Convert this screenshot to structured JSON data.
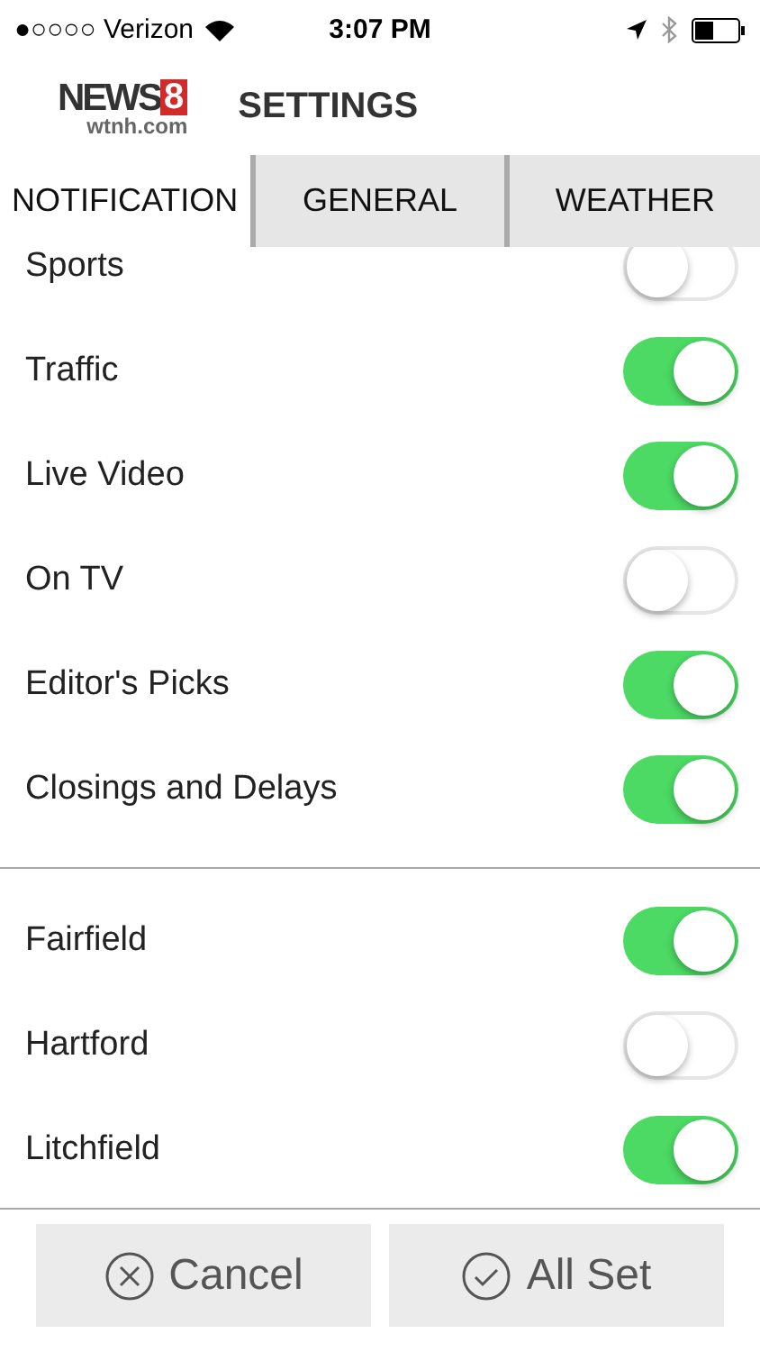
{
  "status_bar": {
    "carrier": "●○○○○ Verizon",
    "time": "3:07 PM"
  },
  "header": {
    "logo": {
      "word": "NEWS",
      "number": "8",
      "site": "wtnh.com"
    },
    "title": "SETTINGS"
  },
  "tabs": [
    {
      "label": "NOTIFICATION",
      "selected": true
    },
    {
      "label": "GENERAL",
      "selected": false
    },
    {
      "label": "WEATHER",
      "selected": false
    }
  ],
  "sections": [
    {
      "items": [
        {
          "label": "Sports",
          "on": false
        },
        {
          "label": "Traffic",
          "on": true
        },
        {
          "label": "Live Video",
          "on": true
        },
        {
          "label": "On TV",
          "on": false
        },
        {
          "label": "Editor's Picks",
          "on": true
        },
        {
          "label": "Closings and Delays",
          "on": true
        }
      ]
    },
    {
      "items": [
        {
          "label": "Fairfield",
          "on": true
        },
        {
          "label": "Hartford",
          "on": false
        },
        {
          "label": "Litchfield",
          "on": true
        }
      ]
    }
  ],
  "buttons": [
    {
      "kind": "cancel",
      "label": "Cancel"
    },
    {
      "kind": "confirm",
      "label": "All Set"
    }
  ]
}
